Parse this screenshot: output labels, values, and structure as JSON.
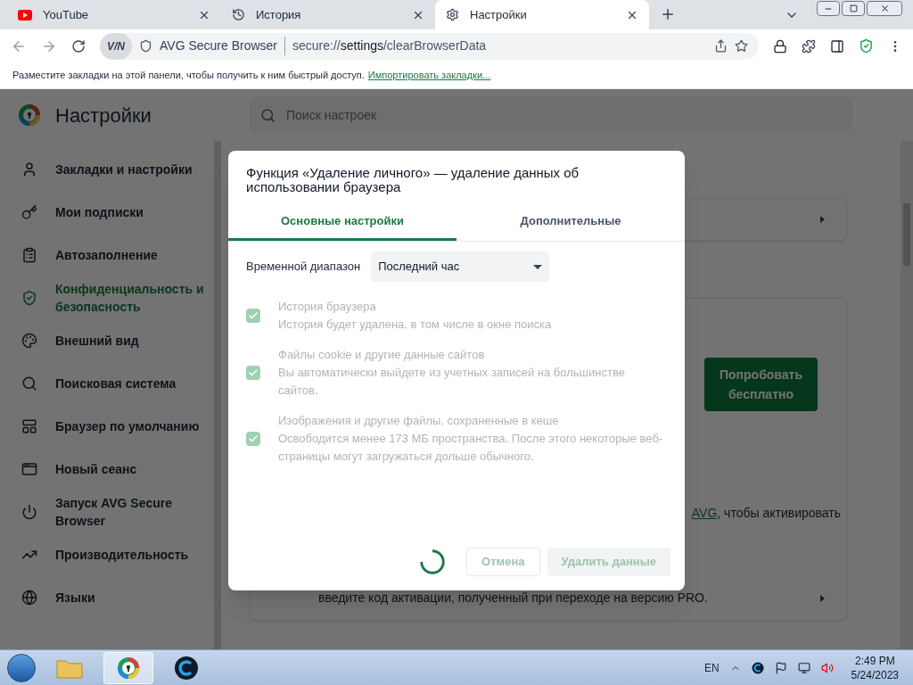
{
  "browser_tabs": [
    {
      "title": "YouTube",
      "selected": false
    },
    {
      "title": "История",
      "selected": false
    },
    {
      "title": "Настройки",
      "selected": true
    }
  ],
  "address_bar": {
    "vpn_label": "V/N",
    "site_name": "AVG Secure Browser",
    "url_scheme": "secure://",
    "url_host": "settings",
    "url_path": "/clearBrowserData"
  },
  "bookmarks_bar": {
    "message": "Разместите закладки на этой панели, чтобы получить к ним быстрый доступ.",
    "link": "Импортировать закладки..."
  },
  "settings": {
    "title": "Настройки",
    "search_placeholder": "Поиск настроек",
    "sidebar_items": [
      {
        "label": "Закладки и настройки",
        "selected": false
      },
      {
        "label": "Мои подписки",
        "selected": false
      },
      {
        "label": "Автозаполнение",
        "selected": false
      },
      {
        "label": "Конфиденциальность и безопасность",
        "selected": true
      },
      {
        "label": "Внешний вид",
        "selected": false
      },
      {
        "label": "Поисковая система",
        "selected": false
      },
      {
        "label": "Браузер по умолчанию",
        "selected": false
      },
      {
        "label": "Новый сеанс",
        "selected": false
      },
      {
        "label": "Запуск AVG Secure Browser",
        "selected": false
      },
      {
        "label": "Производительность",
        "selected": false
      },
      {
        "label": "Языки",
        "selected": false
      }
    ],
    "try_button": "Попробовать бесплатно",
    "note_link": "AVG",
    "note_text": ", чтобы активировать",
    "activation_text": "введите код активации, полученный при переходе на версию PRO."
  },
  "dialog": {
    "title": "Функция «Удаление личного» — удаление данных об использовании браузера",
    "tabs": [
      {
        "label": "Основные настройки",
        "selected": true
      },
      {
        "label": "Дополнительные",
        "selected": false
      }
    ],
    "time_range": {
      "label": "Временной диапазон",
      "value": "Последний час"
    },
    "options": [
      {
        "title": "История браузера",
        "description": "История будет удалена, в том числе в окне поиска",
        "checked": true,
        "disabled": true
      },
      {
        "title": "Файлы cookie и другие данные сайтов",
        "description": "Вы автоматически выйдете из учетных записей на большинстве сайтов.",
        "checked": true,
        "disabled": true
      },
      {
        "title": "Изображения и другие файлы, сохраненные в кеше",
        "description": "Освободится менее 173 МБ пространства. После этого некоторые веб-страницы могут загружаться дольше обычного.",
        "checked": true,
        "disabled": true
      }
    ],
    "loading": true,
    "cancel_button": {
      "label": "Отмена",
      "disabled": true
    },
    "delete_button": {
      "label": "Удалить данные",
      "disabled": true
    }
  },
  "taskbar": {
    "language": "EN",
    "time": "2:49 PM",
    "date": "5/24/2023"
  }
}
